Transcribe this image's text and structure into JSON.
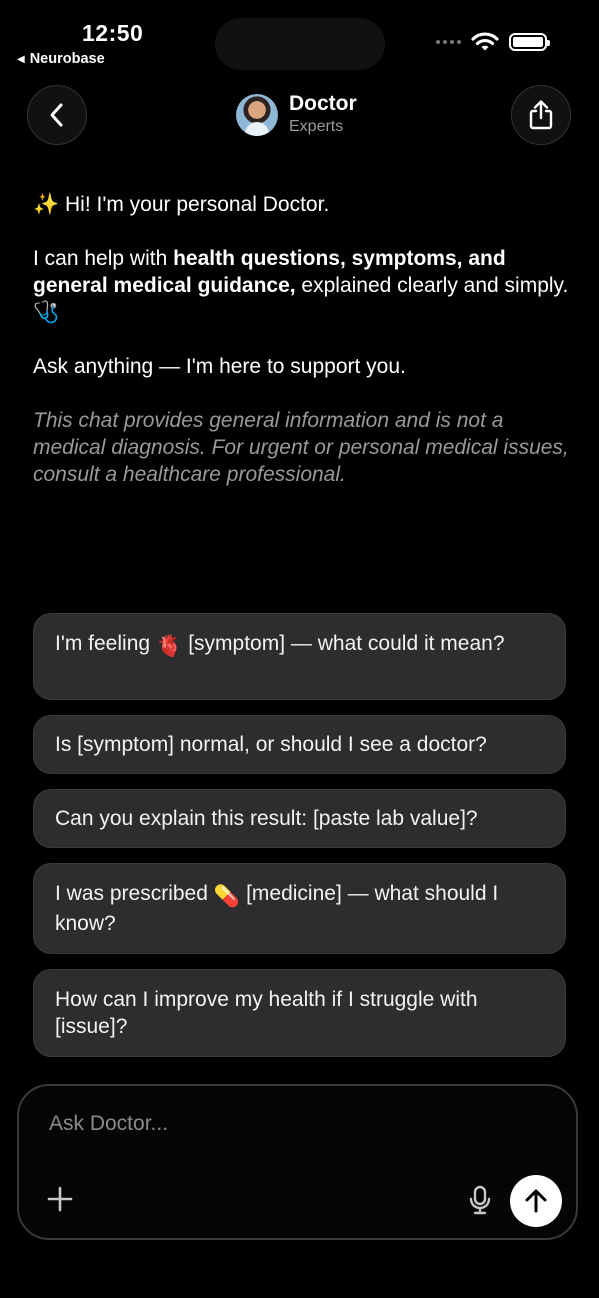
{
  "status": {
    "time": "12:50",
    "back_app": "Neurobase"
  },
  "header": {
    "title": "Doctor",
    "subtitle": "Experts"
  },
  "message": {
    "greeting_emoji": "✨",
    "greeting": "Hi! I'm your personal Doctor.",
    "help_prefix": "I can help with ",
    "help_bold": "health questions, symptoms, and general medical guidance,",
    "help_suffix": " explained clearly and simply.",
    "help_emoji": "🩺",
    "ask": "Ask anything — I'm here to support you.",
    "disclaimer": "This chat provides general information and is not a medical diagnosis. For urgent or personal medical issues, consult a healthcare professional."
  },
  "suggestions": {
    "s1_before": "I'm feeling",
    "s1_emoji": "🫀",
    "s1_after": "[symptom] — what could it mean?",
    "s2": "Is [symptom] normal, or should I see a doctor?",
    "s3": "Can you explain this result: [paste lab value]?",
    "s4_before": "I was prescribed",
    "s4_emoji": "💊",
    "s4_after": "[medicine] — what should I know?",
    "s5": "How can I improve my health if I struggle with [issue]?"
  },
  "composer": {
    "placeholder": "Ask Doctor..."
  }
}
